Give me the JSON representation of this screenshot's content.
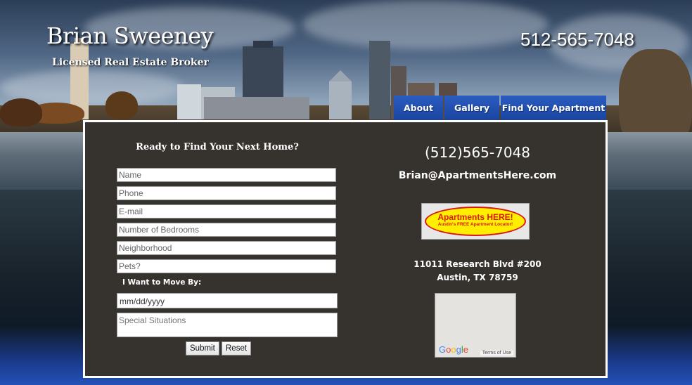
{
  "header": {
    "name": "Brian Sweeney",
    "subtitle": "Licensed Real Estate Broker",
    "phone": "512-565-7048"
  },
  "nav": {
    "about": "About",
    "gallery": "Gallery",
    "find": "Find Your Apartment",
    "color": "#1f4fb4"
  },
  "form": {
    "title": "Ready to Find Your Next Home?",
    "name_placeholder": "Name",
    "phone_placeholder": "Phone",
    "email_placeholder": "E-mail",
    "bedrooms_placeholder": "Number of Bedrooms",
    "neighborhood_placeholder": "Neighborhood",
    "pets_placeholder": "Pets?",
    "move_label": "I Want to Move By:",
    "date_value": "mm/dd/yyyy",
    "special_placeholder": "Special Situations",
    "submit": "Submit",
    "reset": "Reset"
  },
  "contact": {
    "phone": "(512)565-7048",
    "email": "Brian@ApartmentsHere.com",
    "logo_text": "Apartments HERE!",
    "logo_tagline": "Austin's FREE Apartment Locator!",
    "address_line1": "11011 Research Blvd #200",
    "address_line2": "Austin, TX 78759",
    "map_terms": "Terms of Use"
  },
  "panel_color": "#36332f"
}
